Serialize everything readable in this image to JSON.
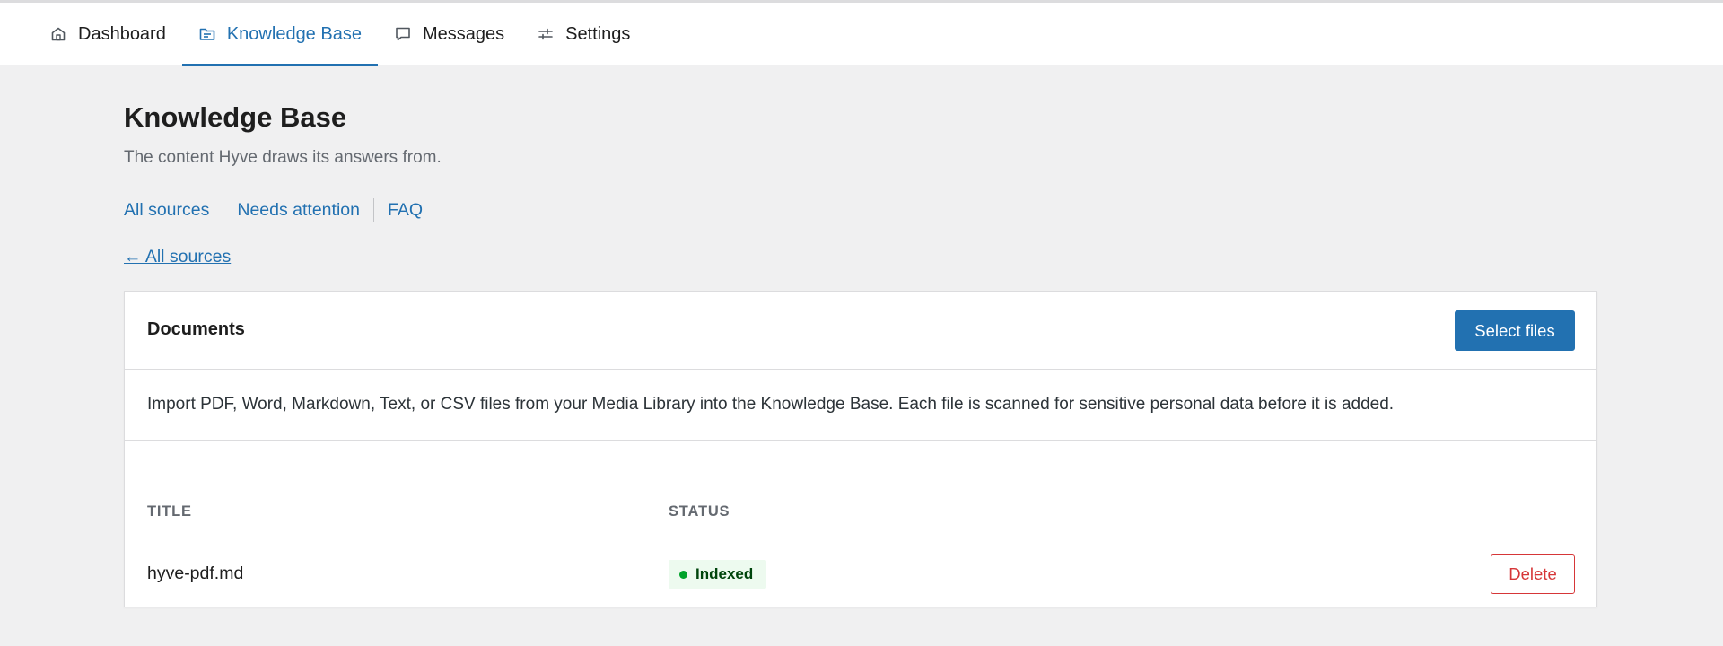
{
  "nav": {
    "tabs": [
      {
        "label": "Dashboard",
        "icon": "home-icon",
        "active": false
      },
      {
        "label": "Knowledge Base",
        "icon": "folder-icon",
        "active": true
      },
      {
        "label": "Messages",
        "icon": "message-icon",
        "active": false
      },
      {
        "label": "Settings",
        "icon": "sliders-icon",
        "active": false
      }
    ]
  },
  "page": {
    "title": "Knowledge Base",
    "subtitle": "The content Hyve draws its answers from."
  },
  "subnav": {
    "links": [
      "All sources",
      "Needs attention",
      "FAQ"
    ]
  },
  "back_link": "← All sources",
  "documents": {
    "title": "Documents",
    "select_files_label": "Select files",
    "description": "Import PDF, Word, Markdown, Text, or CSV files from your Media Library into the Knowledge Base. Each file is scanned for sensitive personal data before it is added.",
    "columns": [
      "TITLE",
      "STATUS"
    ],
    "rows": [
      {
        "title": "hyve-pdf.md",
        "status": "Indexed",
        "action": "Delete"
      }
    ]
  },
  "colors": {
    "accent": "#2271b1",
    "danger": "#d63638",
    "success": "#00a32a",
    "background": "#f0f0f1"
  }
}
